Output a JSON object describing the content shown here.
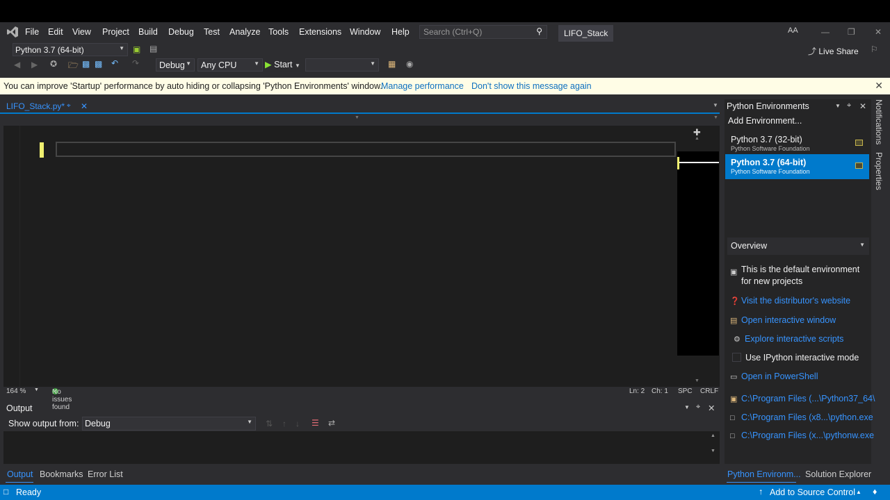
{
  "menu": {
    "items": [
      "File",
      "Edit",
      "View",
      "Project",
      "Build",
      "Debug",
      "Test",
      "Analyze",
      "Tools",
      "Extensions",
      "Window",
      "Help"
    ],
    "search_placeholder": "Search (Ctrl+Q)",
    "solution_name": "LIFO_Stack",
    "user_initials": "AA",
    "live_share": "Live Share"
  },
  "toolbar": {
    "python_env": "Python 3.7 (64-bit)",
    "configuration": "Debug",
    "platform": "Any CPU",
    "start_label": "Start"
  },
  "infobar": {
    "message": "You can improve 'Startup' performance by auto hiding or collapsing 'Python Environments' window.",
    "link1": "Manage performance",
    "link2": "Don't show this message again"
  },
  "editor": {
    "tab_title": "LIFO_Stack.py*",
    "zoom": "164 %",
    "issues": "No issues found",
    "line": "Ln: 2",
    "col": "Ch: 1",
    "spacing": "SPC",
    "line_ending": "CRLF"
  },
  "output": {
    "title": "Output",
    "show_from_label": "Show output from:",
    "source": "Debug",
    "tabs": [
      "Output",
      "Bookmarks",
      "Error List"
    ]
  },
  "python_environments": {
    "title": "Python Environments",
    "add": "Add Environment...",
    "envs": [
      {
        "name": "Python 3.7 (32-bit)",
        "vendor": "Python Software Foundation"
      },
      {
        "name": "Python 3.7 (64-bit)",
        "vendor": "Python Software Foundation"
      }
    ],
    "overview_label": "Overview",
    "default_note": "This is the default environment for new projects",
    "links": [
      "Visit the distributor's website",
      "Open interactive window",
      "Explore interactive scripts"
    ],
    "ipython_label": "Use IPython interactive mode",
    "powershell": "Open in PowerShell",
    "paths": [
      "C:\\Program Files (...\\Python37_64\\",
      "C:\\Program Files (x8...\\python.exe",
      "C:\\Program Files (x...\\pythonw.exe"
    ],
    "bottom_tabs": [
      "Python Environm...",
      "Solution Explorer"
    ]
  },
  "side_tabs": [
    "Notifications",
    "Properties"
  ],
  "statusbar": {
    "ready": "Ready",
    "source_control": "Add to Source Control"
  }
}
